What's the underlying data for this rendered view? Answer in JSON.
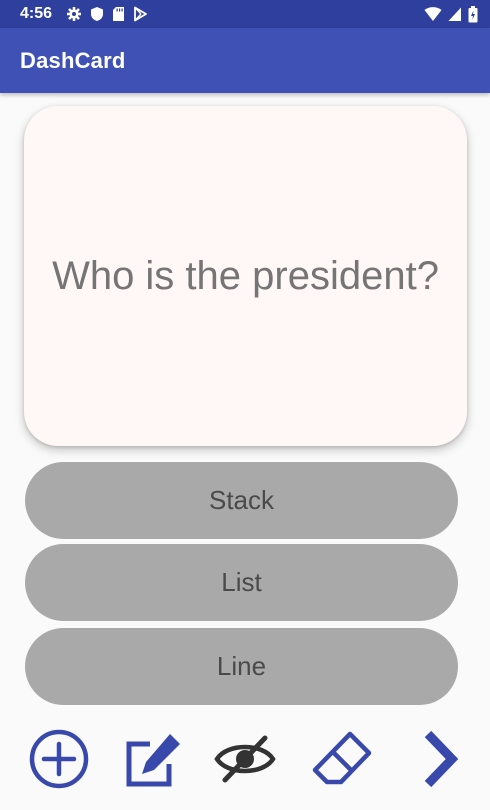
{
  "status_bar": {
    "time": "4:56",
    "icons_left": [
      "settings-icon",
      "shield-icon",
      "sd-card-icon",
      "play-store-icon"
    ],
    "icons_right": [
      "wifi-icon",
      "cell-signal-icon",
      "battery-icon"
    ]
  },
  "app_bar": {
    "title": "DashCard"
  },
  "card": {
    "question": "Who is the president?"
  },
  "answers": [
    {
      "label": "Stack"
    },
    {
      "label": "List"
    },
    {
      "label": "Line"
    }
  ],
  "toolbar": {
    "icons": [
      "add-icon",
      "edit-icon",
      "hide-icon",
      "erase-icon",
      "next-icon"
    ],
    "accent_color": "#3949ab"
  },
  "colors": {
    "status_bar": "#2f3f9e",
    "app_bar": "#3f51b5",
    "card_background": "#fff8f6",
    "answer_button": "#a9a9a9"
  }
}
